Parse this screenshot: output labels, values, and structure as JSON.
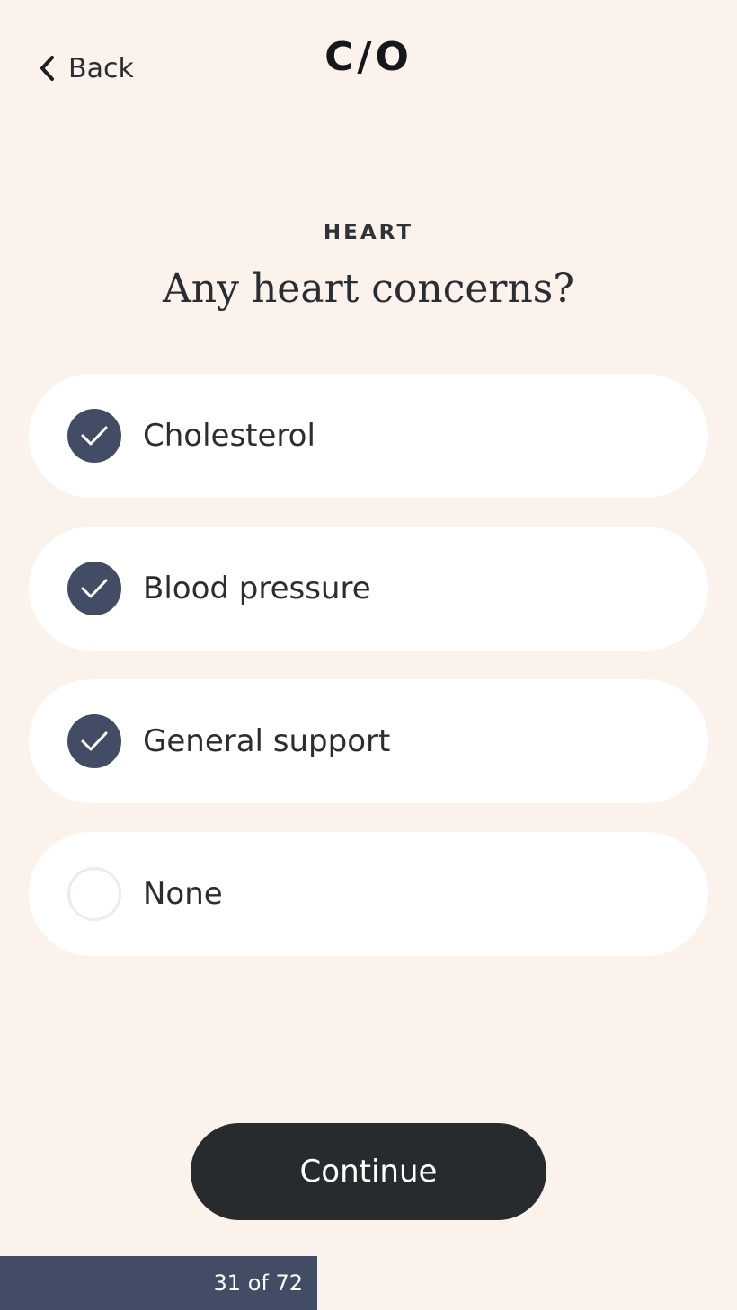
{
  "header": {
    "back_label": "Back",
    "logo": "C/O"
  },
  "section_label": "HEART",
  "question": "Any heart concerns?",
  "options": [
    {
      "label": "Cholesterol",
      "checked": true
    },
    {
      "label": "Blood pressure",
      "checked": true
    },
    {
      "label": "General support",
      "checked": true
    },
    {
      "label": "None",
      "checked": false
    }
  ],
  "continue_label": "Continue",
  "progress": {
    "text": "31 of 72",
    "current": 31,
    "total": 72
  },
  "colors": {
    "background": "#fcf2ec",
    "accent": "#434c65",
    "button": "#282b2e"
  }
}
